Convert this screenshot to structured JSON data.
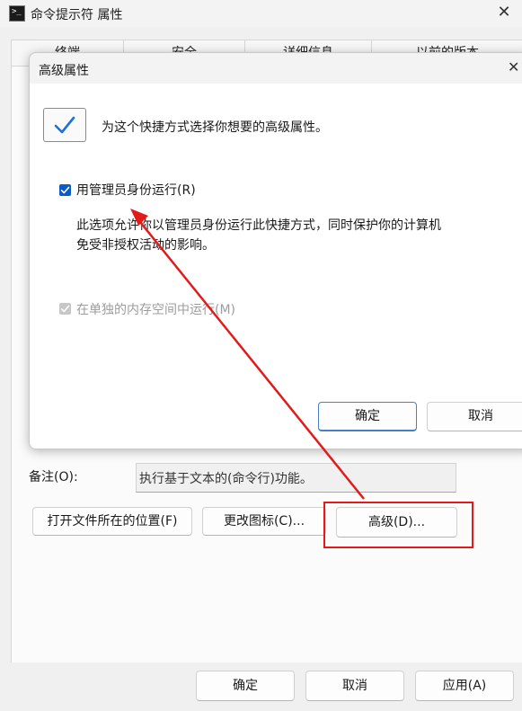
{
  "window": {
    "title": "命令提示符 属性",
    "close_glyph": "✕",
    "icon_glyph": ">_"
  },
  "tabs": [
    {
      "label": "终端"
    },
    {
      "label": "安全"
    },
    {
      "label": "详细信息"
    },
    {
      "label": "以前的版本"
    }
  ],
  "properties": {
    "comment_label": "备注(O):",
    "comment_value": "执行基于文本的(命令行)功能。",
    "open_location_label": "打开文件所在的位置(F)",
    "change_icon_label": "更改图标(C)...",
    "advanced_label": "高级(D)..."
  },
  "footer": {
    "ok_label": "确定",
    "cancel_label": "取消",
    "apply_label": "应用(A)"
  },
  "dialog": {
    "title": "高级属性",
    "close_glyph": "✕",
    "header_text": "为这个快捷方式选择你想要的高级属性。",
    "run_as_admin": {
      "label": "用管理员身份运行(R)",
      "checked": true
    },
    "description": "此选项允许你以管理员身份运行此快捷方式，同时保护你的计算机\n免受非授权活动的影响。",
    "separate_memory": {
      "label": "在单独的内存空间中运行(M)",
      "checked": true,
      "disabled": true
    },
    "ok_label": "确定",
    "cancel_label": "取消"
  },
  "icons": {
    "shortcut_illustration": "checkmark-icon",
    "checkbox_check": "check-icon"
  },
  "colors": {
    "accent": "#0a5bc7",
    "annotation": "#e21a1a",
    "disabled_text": "#9c9c9c"
  }
}
